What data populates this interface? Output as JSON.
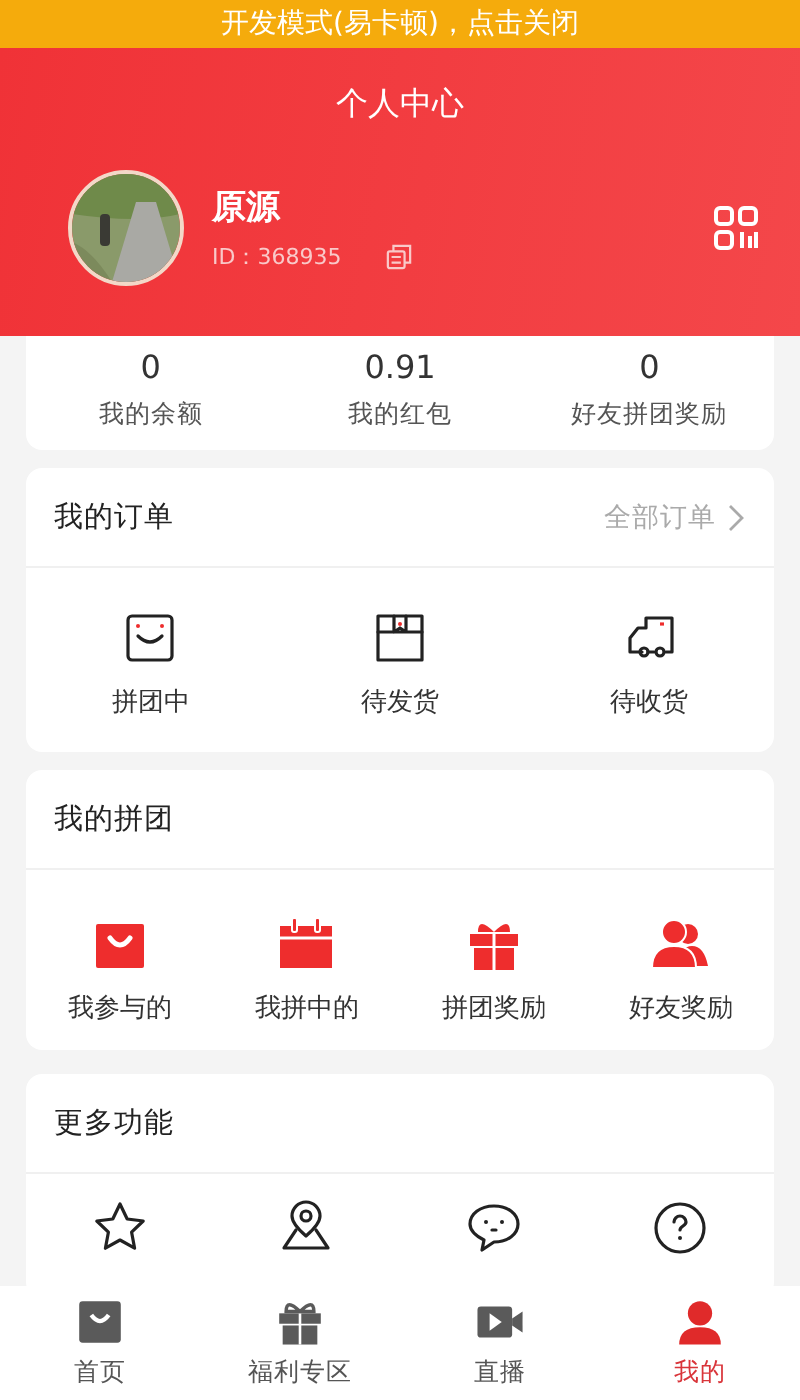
{
  "dev_banner": "开发模式(易卡顿)，点击关闭",
  "header": {
    "title": "个人中心",
    "user": {
      "name": "原源",
      "id_label": "ID：368935"
    }
  },
  "stats": [
    {
      "value": "0",
      "label": "我的余额"
    },
    {
      "value": "0.91",
      "label": "我的红包"
    },
    {
      "value": "0",
      "label": "好友拼团奖励"
    }
  ],
  "orders": {
    "title": "我的订单",
    "link": "全部订单",
    "items": [
      {
        "kind": "smile-box",
        "label": "拼团中"
      },
      {
        "kind": "package",
        "label": "待发货"
      },
      {
        "kind": "truck",
        "label": "待收货"
      }
    ]
  },
  "group_buy": {
    "title": "我的拼团",
    "items": [
      {
        "kind": "bag",
        "label": "我参与的"
      },
      {
        "kind": "calendar",
        "label": "我拼中的"
      },
      {
        "kind": "gift",
        "label": "拼团奖励"
      },
      {
        "kind": "people",
        "label": "好友奖励"
      }
    ]
  },
  "more": {
    "title": "更多功能",
    "items": [
      {
        "kind": "star"
      },
      {
        "kind": "pin"
      },
      {
        "kind": "chat"
      },
      {
        "kind": "question"
      }
    ]
  },
  "tab_bar": [
    {
      "kind": "bag",
      "label": "首页",
      "selected": false
    },
    {
      "kind": "gift",
      "label": "福利专区",
      "selected": false
    },
    {
      "kind": "video",
      "label": "直播",
      "selected": false
    },
    {
      "kind": "person",
      "label": "我的",
      "selected": true
    }
  ]
}
